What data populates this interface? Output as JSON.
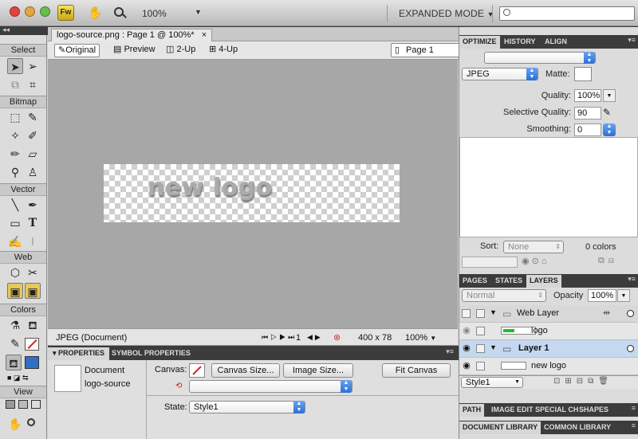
{
  "titlebar": {
    "zoom": "100%",
    "workspace": "EXPANDED MODE",
    "app_logo": "Fw"
  },
  "tools": {
    "sections": [
      "Select",
      "Bitmap",
      "Vector",
      "Web",
      "Colors",
      "View"
    ]
  },
  "document": {
    "tab_title": "logo-source.png : Page 1 @ 100%*",
    "tab_close": "×",
    "views": [
      "Original",
      "Preview",
      "2-Up",
      "4-Up"
    ],
    "page": "Page 1",
    "canvas_text": "new logo"
  },
  "status": {
    "format": "JPEG (Document)",
    "frame": "1",
    "size": "400 x 78",
    "zoom": "100%"
  },
  "properties": {
    "tabs": [
      "PROPERTIES",
      "SYMBOL PROPERTIES"
    ],
    "doc_label": "Document",
    "doc_name": "logo-source",
    "canvas_label": "Canvas:",
    "canvas_size_btn": "Canvas Size...",
    "image_size_btn": "Image Size...",
    "fit_canvas_btn": "Fit Canvas",
    "state_label": "State:",
    "state_value": "Style1"
  },
  "optimize": {
    "tabs": [
      "OPTIMIZE",
      "HISTORY",
      "ALIGN"
    ],
    "format": "JPEG",
    "matte_label": "Matte:",
    "quality_label": "Quality:",
    "quality": "100%",
    "sel_quality_label": "Selective Quality:",
    "sel_quality": "90",
    "smoothing_label": "Smoothing:",
    "smoothing": "0",
    "sort_label": "Sort:",
    "sort_value": "None",
    "colors_count": "0 colors"
  },
  "layers": {
    "tabs": [
      "PAGES",
      "STATES",
      "LAYERS"
    ],
    "blend": "Normal",
    "opacity_label": "Opacity",
    "opacity": "100%",
    "rows": [
      {
        "name": "Web Layer"
      },
      {
        "name": "logo"
      },
      {
        "name": "Layer 1"
      },
      {
        "name": "new logo"
      }
    ],
    "style_value": "Style1"
  },
  "bottom_panels": {
    "row1": [
      "PATH",
      "IMAGE EDIT",
      "SPECIAL CH",
      "SHAPES"
    ],
    "row2": [
      "DOCUMENT LIBRARY",
      "COMMON LIBRARY"
    ]
  },
  "colors": {
    "accent": "#2c6fd6",
    "selection": "#c4d8f0",
    "fill_swatch": "#2f6fc4",
    "stroke_swatch": "#cc2222"
  }
}
